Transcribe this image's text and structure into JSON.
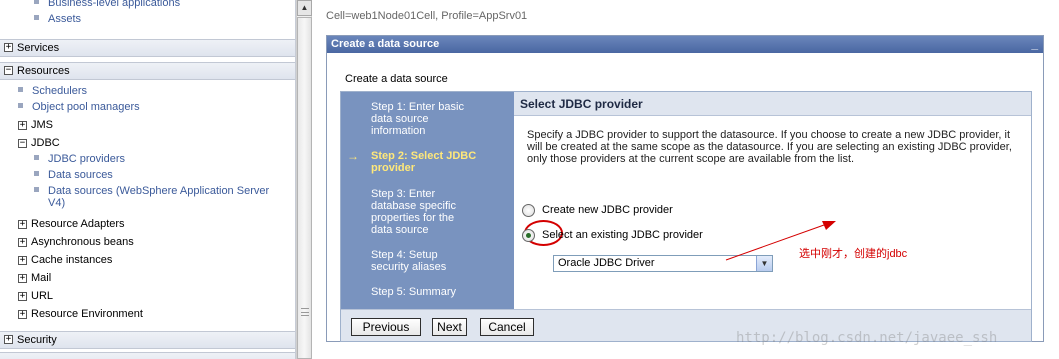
{
  "nav": {
    "top_items": [
      "Business-level applications",
      "Assets"
    ],
    "services_label": "Services",
    "resources_label": "Resources",
    "resource_links": [
      "Schedulers",
      "Object pool managers"
    ],
    "jms_label": "JMS",
    "jdbc_label": "JDBC",
    "jdbc_links": [
      "JDBC providers",
      "Data sources",
      "Data sources (WebSphere Application Server",
      "V4)"
    ],
    "more_items": [
      "Resource Adapters",
      "Asynchronous beans",
      "Cache instances",
      "Mail",
      "URL",
      "Resource Environment"
    ],
    "security_label": "Security"
  },
  "breadcrumb": "Cell=web1Node01Cell, Profile=AppSrv01",
  "panel": {
    "title": "Create a data source",
    "minimize": "_",
    "section_title": "Create a data source"
  },
  "steps": [
    {
      "lines": [
        "Step 1: Enter basic",
        "data source",
        "information"
      ],
      "current": false
    },
    {
      "lines": [
        "Step 2: Select JDBC",
        "provider"
      ],
      "current": true
    },
    {
      "lines": [
        "Step 3: Enter",
        "database specific",
        "properties for the",
        "data source"
      ],
      "current": false
    },
    {
      "lines": [
        "Step 4: Setup",
        "security aliases"
      ],
      "current": false
    },
    {
      "lines": [
        "Step 5: Summary"
      ],
      "current": false
    }
  ],
  "current_arrow": "→",
  "content": {
    "header": "Select JDBC provider",
    "description": "Specify a JDBC provider to support the datasource. If you choose to create a new JDBC provider, it will be created at the same scope as the datasource. If you are selecting an existing JDBC provider, only those providers at the current scope are available from the list.",
    "option_new": "Create new JDBC provider",
    "option_existing": "Select an existing JDBC provider",
    "selected_option": "existing",
    "provider_select_value": "Oracle JDBC Driver"
  },
  "annotation": "选中刚才，创建的jdbc",
  "buttons": {
    "previous": "Previous",
    "next": "Next",
    "cancel": "Cancel"
  },
  "watermark": "http://blog.csdn.net/javaee_ssh",
  "colors": {
    "title_bar": "#4a67a2",
    "steps_panel": "#7993bf",
    "current_step": "#ffe87a",
    "annotation_red": "#d40000"
  },
  "icons": {
    "expand": "plus-box",
    "collapse": "minus-box",
    "current_step": "right-arrow",
    "dropdown": "chevron-down"
  }
}
